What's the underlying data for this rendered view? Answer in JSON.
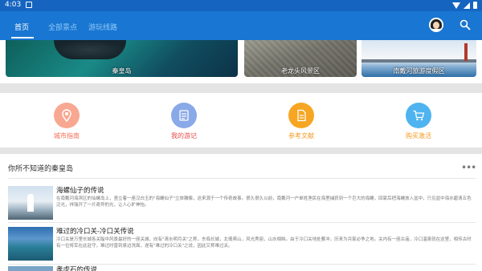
{
  "status_bar": {
    "time": "4:03"
  },
  "tabs": [
    {
      "label": "首页"
    },
    {
      "label": "全部景点"
    },
    {
      "label": "游玩线路"
    }
  ],
  "icons": {
    "avatar": "avatar",
    "search": "search-icon",
    "more": "more-horiz-icon"
  },
  "colors": {
    "primary": "#1976d2",
    "status_bar": "#1565c0",
    "accent_red": "#e94b4b",
    "accent_orange": "#f39a1f"
  },
  "attractions": [
    {
      "name": "秦皇岛"
    },
    {
      "name": "老龙头风景区"
    },
    {
      "name": "南戴河旅游度假区"
    }
  ],
  "quick_links": [
    {
      "label": "城市指南",
      "icon": "map-marker-icon",
      "color": "#f26c4f",
      "bg": "#f8a892"
    },
    {
      "label": "我的游记",
      "icon": "notebook-icon",
      "color": "#e94b4b",
      "bg": "#8aa9e8"
    },
    {
      "label": "参考文献",
      "icon": "document-icon",
      "color": "#f39a1f",
      "bg": "#f6a623"
    },
    {
      "label": "购买激活",
      "icon": "cart-icon",
      "color": "#f39a1f",
      "bg": "#4fb3f0"
    }
  ],
  "section": {
    "title": "你所不知道的秦皇岛",
    "more": "•••"
  },
  "articles": [
    {
      "title": "海螺仙子的传说",
      "desc": "在南戴河海滨区的仙螺岛上，竖立着一座汉白玉的\"海螺仙子\"立体雕像，这来源于一个传奇故事。很久很久以前，南戴河一户单姓渔民在海里捕获到一个巨大的海螺，回家后把海螺放入盆中，只见盆中海水碧清五色泛光，祥瑞开了一片奇异的光，让人心旷神怡。"
    },
    {
      "title": "难过的冷口关-冷口关传说",
      "desc": "冷口关是万里长城各关隘中风景最好的一座关城，向有\"清水明月关\"之称，东临长城，北倚燕山，风光秀丽，山水相映。由于冷口关地处要冲，历来为兵家必争之地。关内有一座古庙，冷口温泉就在这里，相传古时有一位将军在此驻守，难过时曾到泉边洗面，遂有\"难过的冷口关\"之说，因此又称难过关。"
    },
    {
      "title": "孝虎石的传说",
      "desc": ""
    }
  ]
}
